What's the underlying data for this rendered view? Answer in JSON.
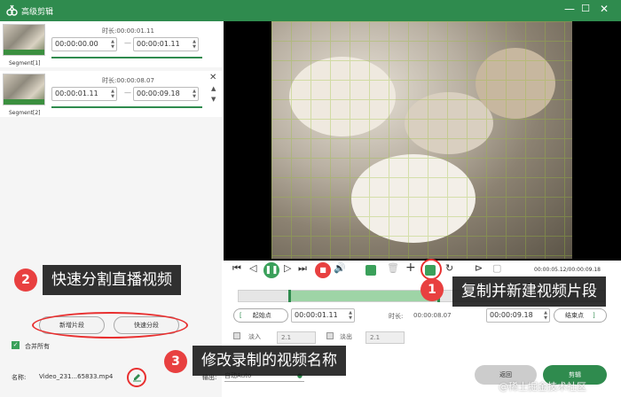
{
  "window": {
    "title": "高级剪辑"
  },
  "segments": [
    {
      "label": "Segment[1]",
      "duration_label": "时长:",
      "duration": "00:00:01.11",
      "start": "00:00:00.00",
      "end": "00:00:01.11"
    },
    {
      "label": "Segment[2]",
      "duration_label": "时长:",
      "duration": "00:00:08.07",
      "start": "00:00:01.11",
      "end": "00:00:09.18"
    }
  ],
  "playback": {
    "time": "00:00:05.12/00:00:09.18"
  },
  "trim": {
    "start_label": "起始点",
    "start": "00:00:01.11",
    "duration_label": "时长:",
    "duration": "00:00:08.07",
    "end": "00:00:09.18",
    "end_label": "结束点"
  },
  "fade": {
    "in_label": "淡入",
    "in_value": "2.1",
    "out_label": "淡出",
    "out_value": "2.1"
  },
  "buttons": {
    "new_segment": "新增片段",
    "quick_split": "快速分段",
    "cancel": "返回",
    "ok": "剪辑"
  },
  "merge": {
    "label": "合并所有"
  },
  "name": {
    "label": "名称:",
    "value": "Video_231...65833.mp4"
  },
  "output": {
    "label": "输出:",
    "value": "自动Auto"
  },
  "annotations": [
    {
      "num": "1",
      "text": "复制并新建视频片段"
    },
    {
      "num": "2",
      "text": "快速分割直播视频"
    },
    {
      "num": "3",
      "text": "修改录制的视频名称"
    }
  ],
  "watermark": "@稀土掘金技术社区",
  "colors": {
    "accent": "#2f8b4e",
    "danger": "#e84040"
  }
}
